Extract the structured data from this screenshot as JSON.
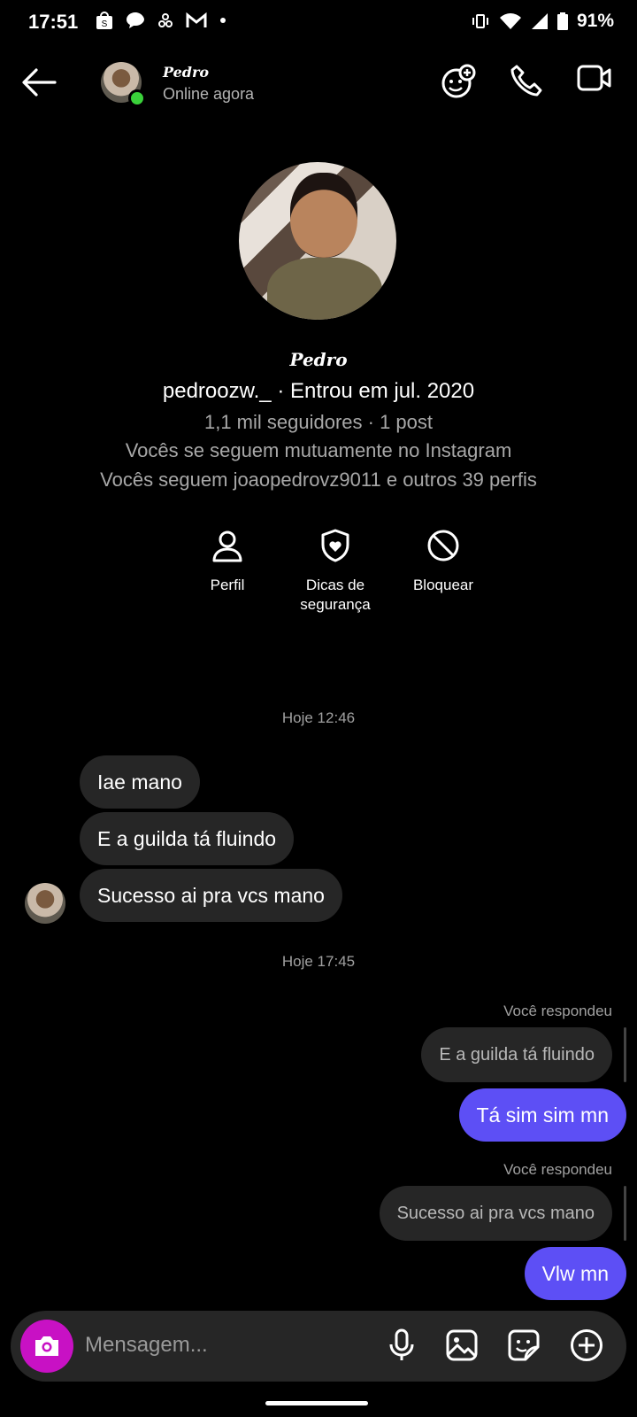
{
  "status_bar": {
    "time": "17:51",
    "battery": "91%"
  },
  "header": {
    "name": "Pedro",
    "status": "Online agora"
  },
  "profile": {
    "name": "Pedro",
    "line1": "pedroozw._ · Entrou em jul. 2020",
    "line2": "1,1 mil seguidores · 1 post",
    "line3": "Vocês se seguem mutuamente no Instagram",
    "line4": "Vocês seguem joaopedrovz9011 e outros 39 perfis",
    "actions": [
      {
        "label": "Perfil"
      },
      {
        "label": "Dicas de segurança"
      },
      {
        "label": "Bloquear"
      }
    ]
  },
  "chat": {
    "timestamp1": "Hoje 12:46",
    "incoming": [
      "Iae mano",
      "E a guilda tá fluindo",
      "Sucesso ai pra vcs mano"
    ],
    "timestamp2": "Hoje 17:45",
    "replies": [
      {
        "label": "Você respondeu",
        "quote": "E a guilda tá fluindo",
        "message": "Tá sim sim mn"
      },
      {
        "label": "Você respondeu",
        "quote": "Sucesso ai pra vcs mano",
        "message": "Vlw mn"
      }
    ]
  },
  "composer": {
    "placeholder": "Mensagem..."
  },
  "colors": {
    "accent": "#5d4ff5",
    "camera": "#c811c4",
    "online": "#3ad13a",
    "bubble": "#262626"
  }
}
